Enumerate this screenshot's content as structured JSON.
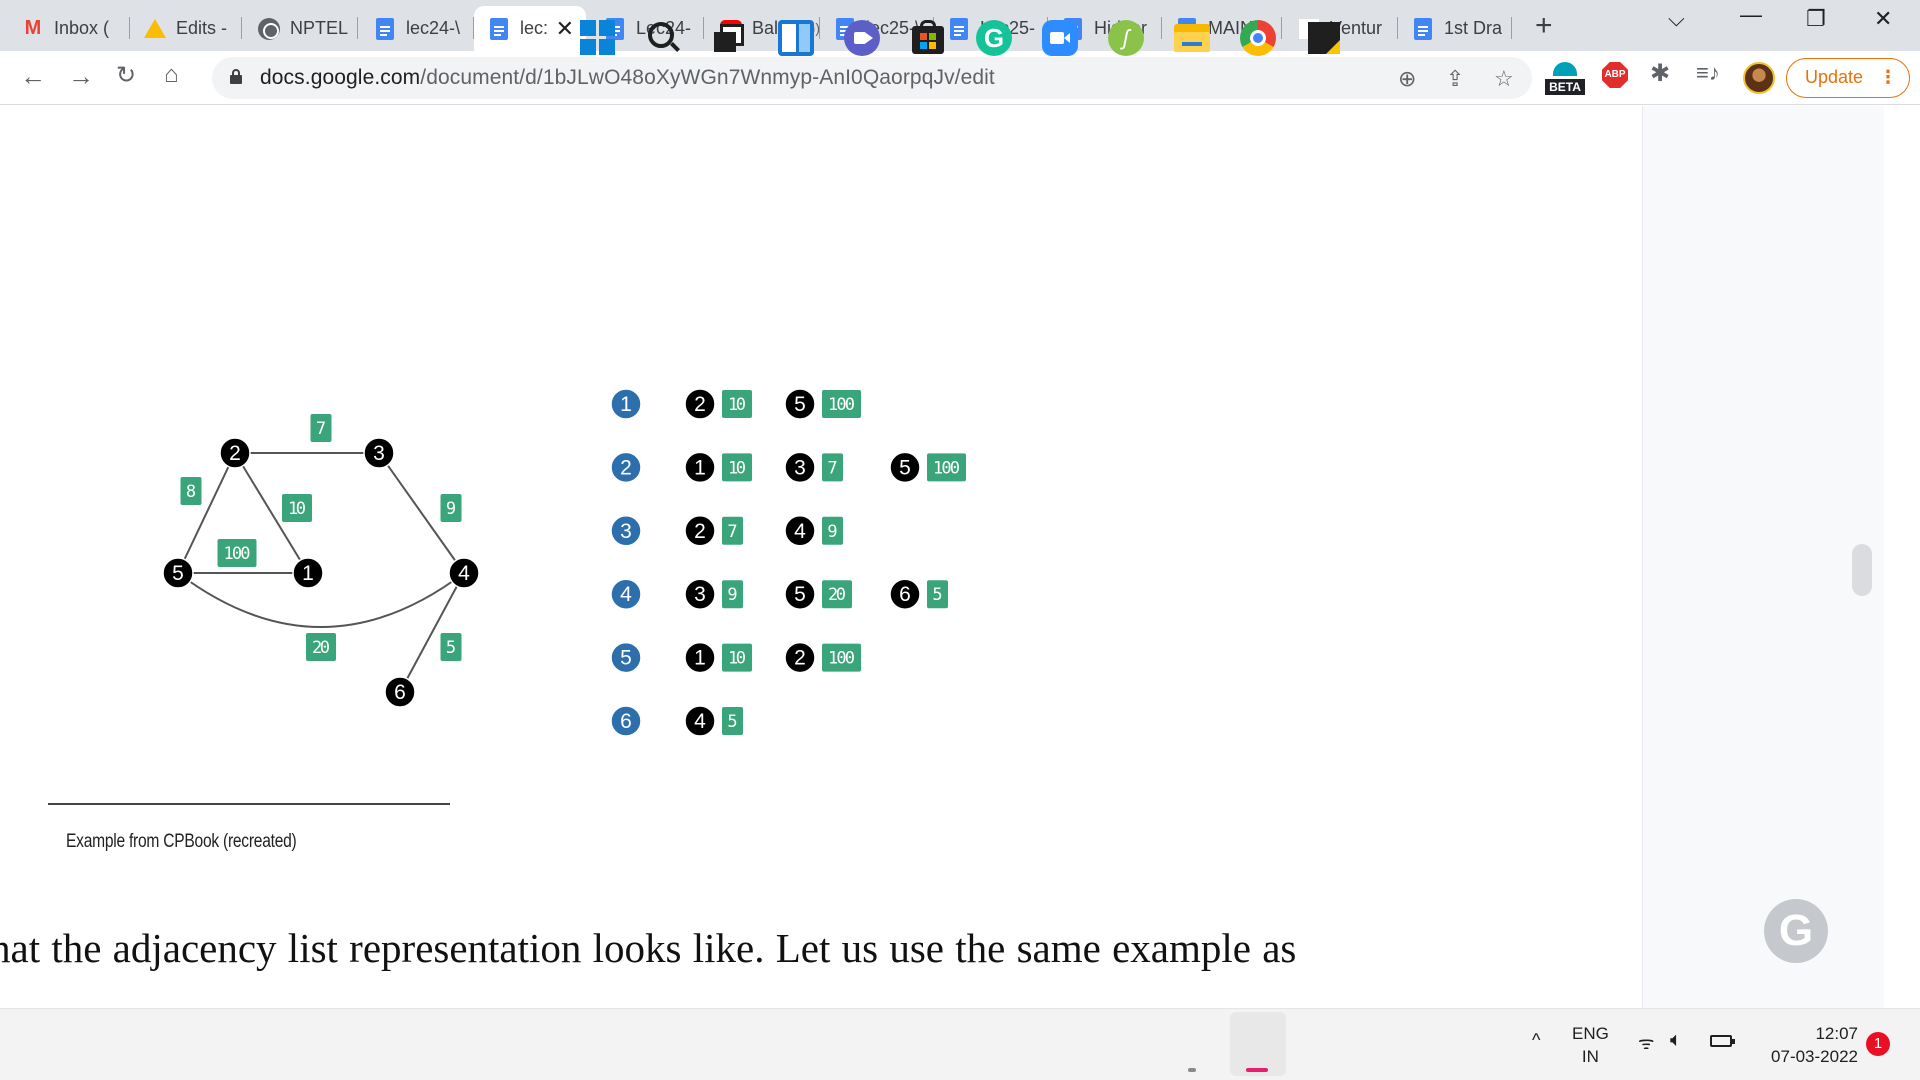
{
  "browser": {
    "tabs": [
      {
        "title": "Inbox (",
        "icon": "gmail-icon",
        "active": false
      },
      {
        "title": "Edits -",
        "icon": "drive-icon",
        "active": false
      },
      {
        "title": "NPTEL",
        "icon": "globe-icon",
        "active": false
      },
      {
        "title": "lec24-\\",
        "icon": "docs-icon",
        "active": false
      },
      {
        "title": "lec:",
        "icon": "docs-icon",
        "active": true
      },
      {
        "title": "Lec24-",
        "icon": "docs-icon",
        "active": false
      },
      {
        "title": "Bal",
        "icon": "youtube-icon",
        "active": false,
        "audio": true
      },
      {
        "title": "lec25-\\",
        "icon": "docs-icon",
        "active": false
      },
      {
        "title": "Lec25-",
        "icon": "docs-icon",
        "active": false
      },
      {
        "title": "Hidder",
        "icon": "docs-icon",
        "active": false
      },
      {
        "title": "MAIN",
        "icon": "docs-icon",
        "active": false
      },
      {
        "title": "Ventur",
        "icon": "blank-page-icon",
        "active": false
      },
      {
        "title": "1st Dra",
        "icon": "docs-icon",
        "active": false
      }
    ],
    "url_host": "docs.google.com",
    "url_path": "/document/d/1bJLwO48oXyWGn7Wnmyp-AnI0QaorpqJv/edit",
    "extensions": {
      "beta_label": "BETA",
      "abp_label": "ABP"
    },
    "update_label": "Update",
    "update_color": "#e8710a"
  },
  "document": {
    "caption": "Example from CPBook (recreated)",
    "body_text": "hat the adjacency list representation looks like. Let us use the same example as",
    "graph": {
      "nodes": [
        "1",
        "2",
        "3",
        "4",
        "5",
        "6"
      ],
      "edges": [
        {
          "from": "2",
          "to": "3",
          "weight": "7"
        },
        {
          "from": "2",
          "to": "5",
          "weight": "8"
        },
        {
          "from": "2",
          "to": "1",
          "weight": "10"
        },
        {
          "from": "3",
          "to": "4",
          "weight": "9"
        },
        {
          "from": "5",
          "to": "1",
          "weight": "100"
        },
        {
          "from": "5",
          "to": "4",
          "weight": "20"
        },
        {
          "from": "4",
          "to": "6",
          "weight": "5"
        }
      ]
    },
    "adjacency_list": [
      {
        "vertex": "1",
        "neighbors": [
          {
            "node": "2",
            "weight": "10"
          },
          {
            "node": "5",
            "weight": "100"
          }
        ]
      },
      {
        "vertex": "2",
        "neighbors": [
          {
            "node": "1",
            "weight": "10"
          },
          {
            "node": "3",
            "weight": "7"
          },
          {
            "node": "5",
            "weight": "100"
          }
        ]
      },
      {
        "vertex": "3",
        "neighbors": [
          {
            "node": "2",
            "weight": "7"
          },
          {
            "node": "4",
            "weight": "9"
          }
        ]
      },
      {
        "vertex": "4",
        "neighbors": [
          {
            "node": "3",
            "weight": "9"
          },
          {
            "node": "5",
            "weight": "20"
          },
          {
            "node": "6",
            "weight": "5"
          }
        ]
      },
      {
        "vertex": "5",
        "neighbors": [
          {
            "node": "1",
            "weight": "10"
          },
          {
            "node": "2",
            "weight": "100"
          }
        ]
      },
      {
        "vertex": "6",
        "neighbors": [
          {
            "node": "4",
            "weight": "5"
          }
        ]
      }
    ],
    "colors": {
      "node": "#000000",
      "vertex": "#2d6fad",
      "weight": "#3aa57a"
    }
  },
  "taskbar": {
    "apps": [
      "start-icon",
      "search-icon",
      "task-view-icon",
      "widgets-icon",
      "teams-chat-icon",
      "microsoft-store-icon",
      "grammarly-icon",
      "zoom-icon",
      "sheets-icon",
      "file-explorer-icon",
      "chrome-icon",
      "sticky-notes-icon"
    ],
    "lang_line1": "ENG",
    "lang_line2": "IN",
    "time": "12:07",
    "date": "07-03-2022",
    "notifications": "1"
  }
}
